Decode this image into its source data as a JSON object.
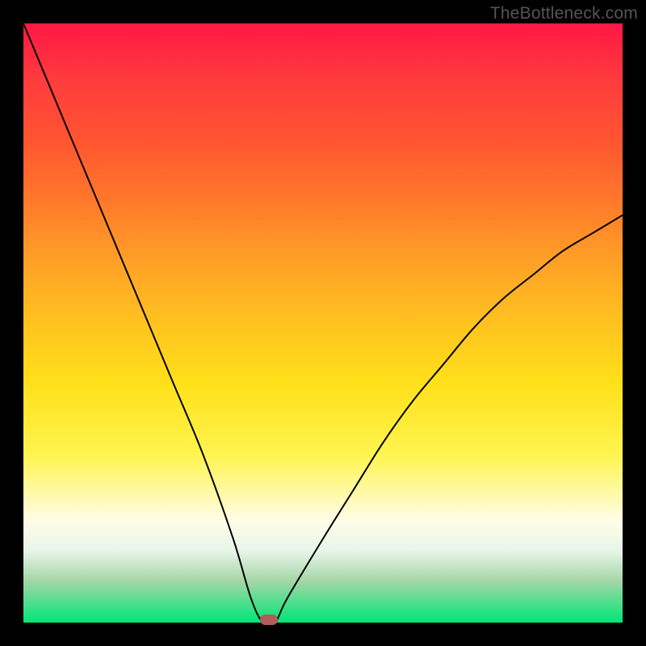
{
  "watermark": "TheBottleneck.com",
  "colors": {
    "frame": "#000000",
    "gradient_top": "#ff1744",
    "gradient_bottom": "#00e676",
    "curve": "#000000",
    "marker": "#b35a5a"
  },
  "chart_data": {
    "type": "line",
    "title": "",
    "xlabel": "",
    "ylabel": "",
    "xlim": [
      0,
      100
    ],
    "ylim": [
      0,
      100
    ],
    "grid": false,
    "legend_position": "none",
    "series": [
      {
        "name": "bottleneck-curve",
        "x": [
          0,
          5,
          10,
          15,
          20,
          25,
          30,
          35,
          38,
          40,
          42,
          44,
          50,
          55,
          60,
          65,
          70,
          75,
          80,
          85,
          90,
          95,
          100
        ],
        "values": [
          100,
          88,
          76,
          64,
          52,
          40,
          28,
          14,
          4,
          0,
          0,
          4,
          14,
          22,
          30,
          37,
          43,
          49,
          54,
          58,
          62,
          65,
          68
        ]
      }
    ],
    "annotations": [
      {
        "name": "optimal-marker",
        "x": 41,
        "y": 0
      }
    ]
  }
}
